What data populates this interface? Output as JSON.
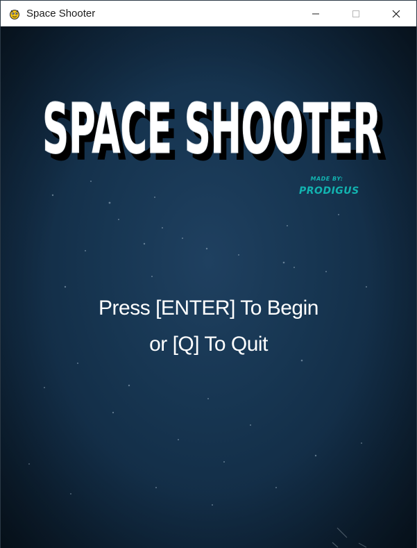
{
  "window": {
    "title": "Space Shooter",
    "app_icon": "pygame-snake-icon",
    "controls": {
      "minimize_icon": "minimize-icon",
      "maximize_icon": "maximize-icon",
      "close_icon": "close-icon"
    }
  },
  "game": {
    "logo_title": "SPACE SHOOTER",
    "credit_label": "MADE BY:",
    "credit_name": "PRODIGUS",
    "prompt_line1": "Press [ENTER] To Begin",
    "prompt_line2": "or [Q] To Quit"
  },
  "colors": {
    "background_center": "#1f4060",
    "background_edge": "#0b1c2c",
    "logo_fill": "#ffffff",
    "logo_shadow": "#000000",
    "credit": "#12b3b0",
    "prompt_text": "#ffffff"
  }
}
